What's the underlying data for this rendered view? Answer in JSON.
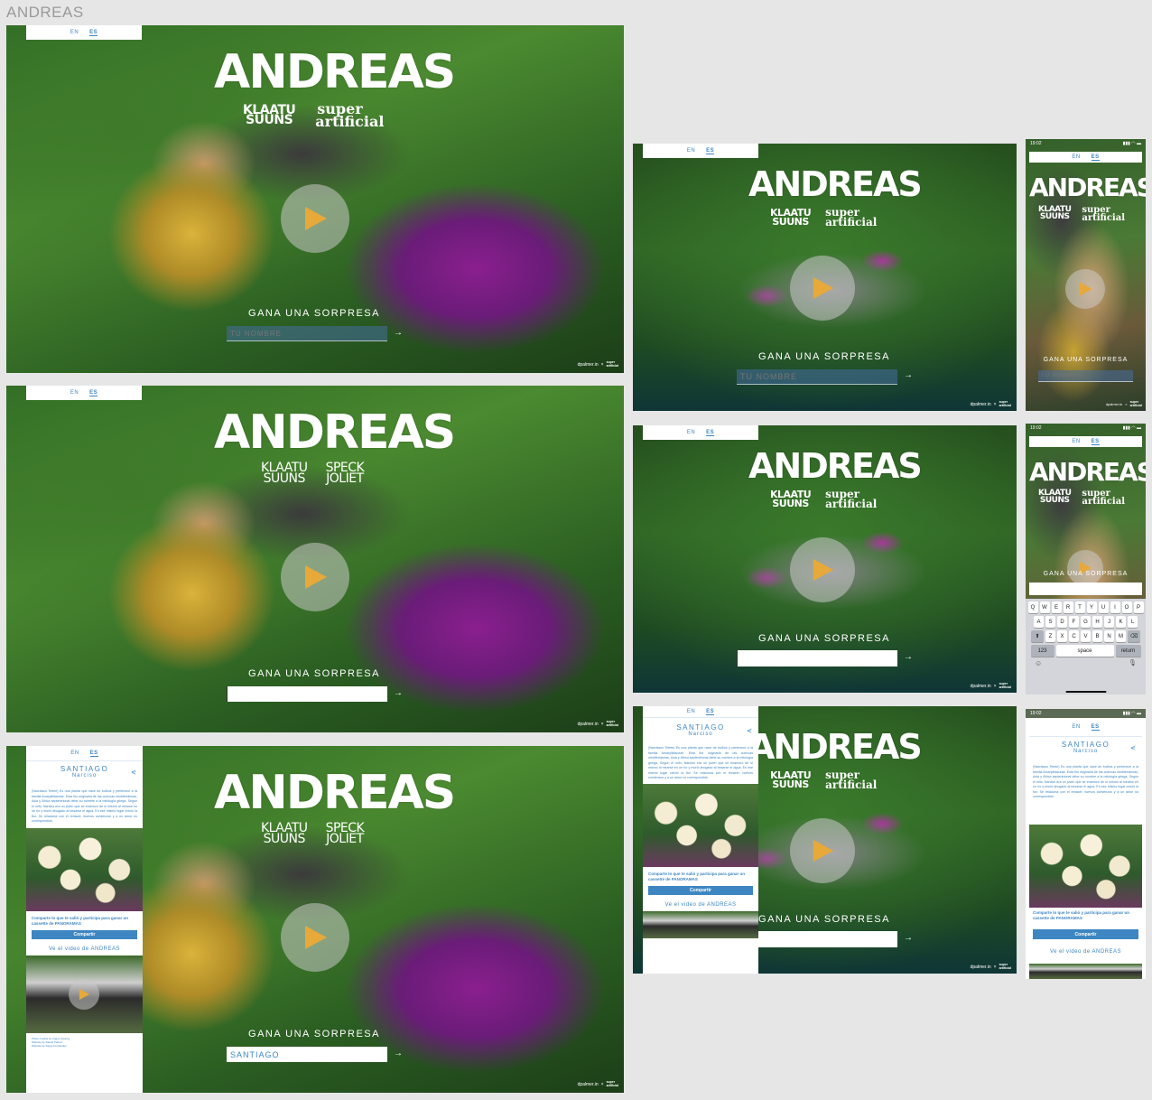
{
  "canvas": {
    "title": "ANDREAS"
  },
  "common": {
    "lang_en": "EN",
    "lang_es": "ES",
    "logo": "ANDREAS",
    "klaatu_line1": "KLAATU",
    "klaatu_line2": "SUUNS",
    "speck_line1": "SPECK",
    "speck_line2": "JOLIET",
    "super_line1": "super",
    "super_line2": "artificial",
    "cta": "GANA UNA SORPRESA",
    "placeholder": "TU NOMBRE",
    "arrow": "→",
    "credits_site": "dpalmer.in",
    "credits_sep": "×",
    "credits_sa1": "super",
    "credits_sa2": "artificial",
    "typed_name": "SANTIAGO"
  },
  "result": {
    "name": "SANTIAGO",
    "subtitle": "Narciso",
    "description": "(Narcissus Tetete) Es una planta que nace de bulbos y pertenece a la familia Amaryllidaceae. Esta flor originaria de las cuencas mediterráneas, Asia y África septentrional debe su nombre a la mitología griega. Según el mito, Narciso era un joven que se enamoró de sí mismo al mirarse en un río y murió ahogado al besarse el agua. En ese mismo lugar creció la flor. Se relaciona con el renacer, nuevos comienzos y a un amor no correspondido.",
    "share_text": "Comparte lo que te salió y participa para ganar un cassette de PANORAMAS",
    "share_button": "Compartir",
    "video_link": "Ve el video de ANDREAS",
    "footer_credits": "Photo Credits by Angus Saunby\nWebsite by Daniel Palmer\nWebsite by Diego Fernández"
  },
  "phone": {
    "time": "19:02",
    "signal": "▮▮▮ ◠ ▬"
  },
  "keyboard": {
    "row1": [
      "Q",
      "W",
      "E",
      "R",
      "T",
      "Y",
      "U",
      "I",
      "O",
      "P"
    ],
    "row2": [
      "A",
      "S",
      "D",
      "F",
      "G",
      "H",
      "J",
      "K",
      "L"
    ],
    "row3": [
      "Z",
      "X",
      "C",
      "V",
      "B",
      "N",
      "M"
    ],
    "shift": "⬆",
    "backspace": "⌫",
    "num": "123",
    "space": "space",
    "return": "return",
    "emoji": "☺",
    "mic": "🎙"
  },
  "colors": {
    "accent": "#3d86c2",
    "play": "#e6a93a",
    "canvas": "#e6e6e6"
  }
}
